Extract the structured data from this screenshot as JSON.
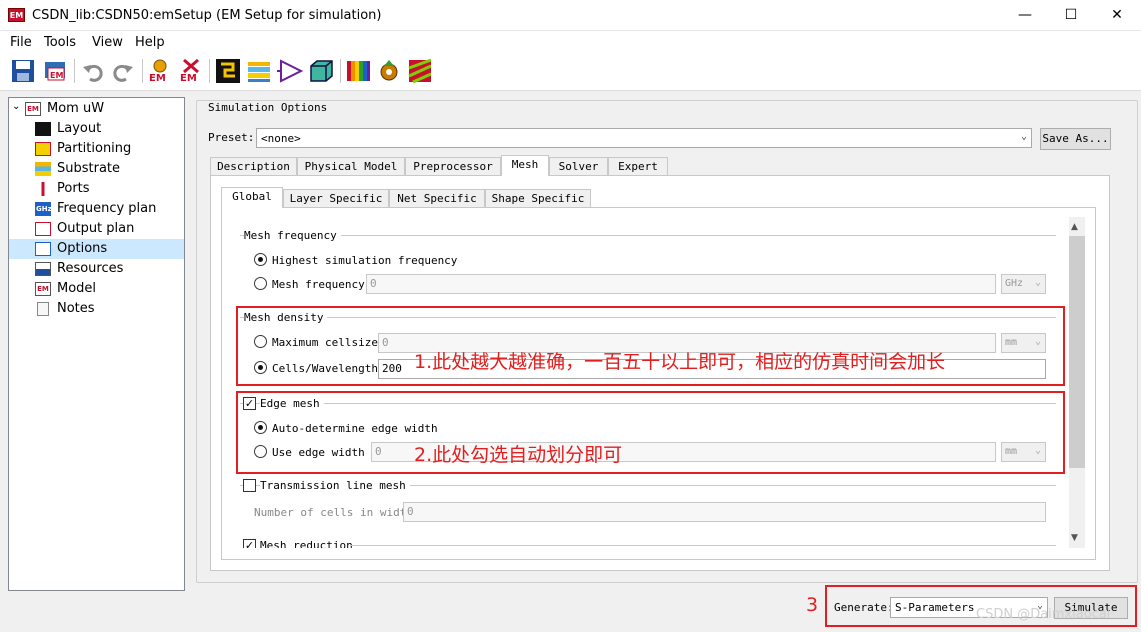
{
  "window": {
    "app_icon": "EM",
    "title": "CSDN_lib:CSDN50:emSetup (EM Setup for simulation)",
    "minimize": "—",
    "maximize": "☐",
    "close": "✕"
  },
  "menu": [
    "File",
    "Tools",
    "View",
    "Help"
  ],
  "toolbar": {
    "icons": [
      "save-icon",
      "save-em-icon",
      "undo-icon",
      "redo-icon",
      "em-setup-icon",
      "em-disabled-icon",
      "layout-icon",
      "substrate-icon",
      "port-icon",
      "3d-view-icon",
      "spectrum-icon",
      "frequency-icon",
      "mesh-icon"
    ],
    "em_label": "EM"
  },
  "tree": {
    "root": "Mom uW",
    "items": [
      {
        "label": "Layout",
        "icon": "layout-icon"
      },
      {
        "label": "Partitioning",
        "icon": "partitioning-icon"
      },
      {
        "label": "Substrate",
        "icon": "substrate-icon"
      },
      {
        "label": "Ports",
        "icon": "ports-icon"
      },
      {
        "label": "Frequency plan",
        "icon": "frequency-icon"
      },
      {
        "label": "Output plan",
        "icon": "output-icon"
      },
      {
        "label": "Options",
        "icon": "options-icon"
      },
      {
        "label": "Resources",
        "icon": "resources-icon"
      },
      {
        "label": "Model",
        "icon": "model-icon"
      },
      {
        "label": "Notes",
        "icon": "notes-icon"
      }
    ],
    "selected": "Options",
    "icon_texts": {
      "root": "EM",
      "frequency": "GHz",
      "model": "EM"
    }
  },
  "options": {
    "group_title": "Simulation Options",
    "preset_label": "Preset:",
    "preset_value": "<none>",
    "save_as": "Save As...",
    "tabs": [
      "Description",
      "Physical Model",
      "Preprocessor",
      "Mesh",
      "Solver",
      "Expert"
    ],
    "active_tab": "Mesh",
    "subtabs": [
      "Global",
      "Layer Specific",
      "Net Specific",
      "Shape Specific"
    ],
    "active_subtab": "Global"
  },
  "mesh": {
    "frequency_title": "Mesh frequency",
    "highest_freq": "Highest simulation frequency",
    "mesh_freq_label": "Mesh frequency",
    "mesh_freq_value": "0",
    "mesh_freq_unit": "GHz",
    "density_title": "Mesh density",
    "max_cellsize_label": "Maximum cellsize",
    "max_cellsize_value": "0",
    "max_cellsize_unit": "mm",
    "cells_wavelength_label": "Cells/Wavelength",
    "cells_wavelength_value": "200",
    "edge_mesh_label": "Edge mesh",
    "auto_edge": "Auto-determine edge width",
    "use_edge_label": "Use edge width",
    "use_edge_value": "0",
    "use_edge_unit": "mm",
    "tline_label": "Transmission line mesh",
    "cells_in_width_label": "Number of cells in width",
    "cells_in_width_value": "0",
    "mesh_reduction_label": "Mesh reduction"
  },
  "annotations": {
    "note1": "1.此处越大越准确，一百五十以上即可，相应的仿真时间会加长",
    "note2": "2.此处勾选自动划分即可",
    "note3": "3"
  },
  "footer": {
    "generate_label": "Generate:",
    "generate_value": "S-Parameters",
    "simulate": "Simulate"
  },
  "watermark": "CSDN @Daimxiaocai",
  "colors": {
    "annotation_red": "#e02020",
    "selection": "#cce8ff"
  }
}
